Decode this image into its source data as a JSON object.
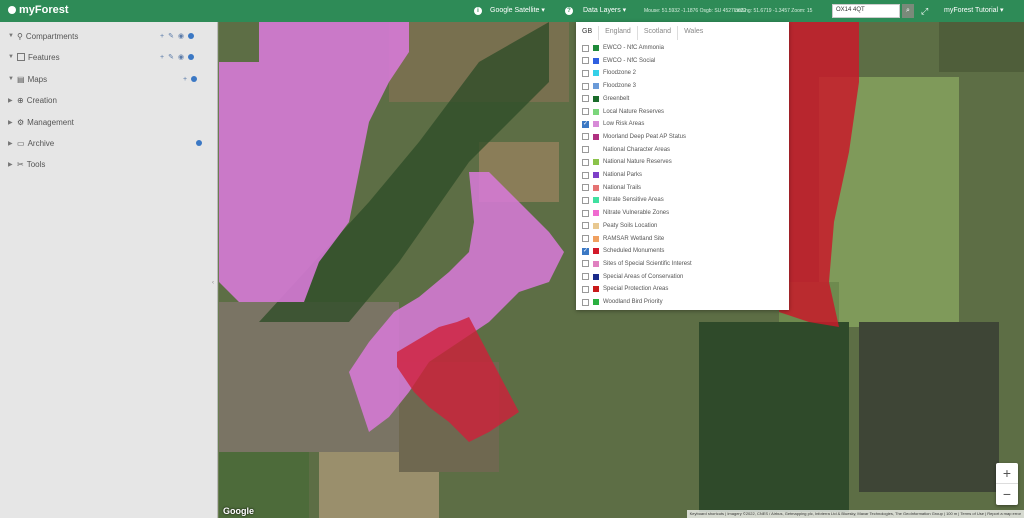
{
  "app": {
    "name": "myForest"
  },
  "topbar": {
    "basemap": "Google Satellite ▾",
    "data_layers": "Data Layers ▾",
    "coord1": "Mouse: 51.5932 -1.1876  Osgb: SU 4527 8632",
    "coord2": "Lat/Lng: 51.6719 -1.3457  Zoom: 15",
    "search_value": "OX14 4QT",
    "user_menu": "myForest Tutorial ▾"
  },
  "sidebar": {
    "items": [
      {
        "label": "Compartments"
      },
      {
        "label": "Features"
      },
      {
        "label": "Maps"
      },
      {
        "label": "Creation"
      },
      {
        "label": "Management"
      },
      {
        "label": "Archive"
      },
      {
        "label": "Tools"
      }
    ]
  },
  "panel": {
    "tabs": [
      "GB",
      "England",
      "Scotland",
      "Wales"
    ],
    "layers": [
      {
        "label": "EWCO - NfC Ammonia",
        "checked": false,
        "color": "#1f8a3a"
      },
      {
        "label": "EWCO - NfC Social",
        "checked": false,
        "color": "#2f5fe0"
      },
      {
        "label": "Floodzone 2",
        "checked": false,
        "color": "#35d0e8"
      },
      {
        "label": "Floodzone 3",
        "checked": false,
        "color": "#6a9ad8"
      },
      {
        "label": "Greenbelt",
        "checked": false,
        "color": "#1a6b2a"
      },
      {
        "label": "Local Nature Reserves",
        "checked": false,
        "color": "#7bd67b"
      },
      {
        "label": "Low Risk Areas",
        "checked": true,
        "color": "#d78ad7"
      },
      {
        "label": "Moorland Deep Peat AP Status",
        "checked": false,
        "color": "#b03080"
      },
      {
        "label": "National Character Areas",
        "checked": false,
        "color": "#ffffff"
      },
      {
        "label": "National Nature Reserves",
        "checked": false,
        "color": "#8bc34a"
      },
      {
        "label": "National Parks",
        "checked": false,
        "color": "#7e3fc8"
      },
      {
        "label": "National Trails",
        "checked": false,
        "color": "#e57373"
      },
      {
        "label": "Nitrate Sensitive Areas",
        "checked": false,
        "color": "#40e0a0"
      },
      {
        "label": "Nitrate Vulnerable Zones",
        "checked": false,
        "color": "#f06bd0"
      },
      {
        "label": "Peaty Soils Location",
        "checked": false,
        "color": "#e8c890"
      },
      {
        "label": "RAMSAR Wetland Site",
        "checked": false,
        "color": "#f0a060"
      },
      {
        "label": "Scheduled Monuments",
        "checked": true,
        "color": "#d21a2a"
      },
      {
        "label": "Sites of Special Scientific Interest",
        "checked": false,
        "color": "#e080c0"
      },
      {
        "label": "Special Areas of Conservation",
        "checked": false,
        "color": "#1a2a8a"
      },
      {
        "label": "Special Protection Areas",
        "checked": false,
        "color": "#c81a1a"
      },
      {
        "label": "Woodland Bird Priority",
        "checked": false,
        "color": "#2ab040"
      }
    ]
  },
  "map": {
    "google_label": "Google",
    "attribution": "Keyboard shortcuts | Imagery ©2022, CNES / Airbus, Getmapping plc, Infoterra Ltd & Bluesky, Maxar Technologies, The GeoInformation Group | 100 m | Terms of Use | Report a map error",
    "zoom_in": "+",
    "zoom_out": "−"
  }
}
